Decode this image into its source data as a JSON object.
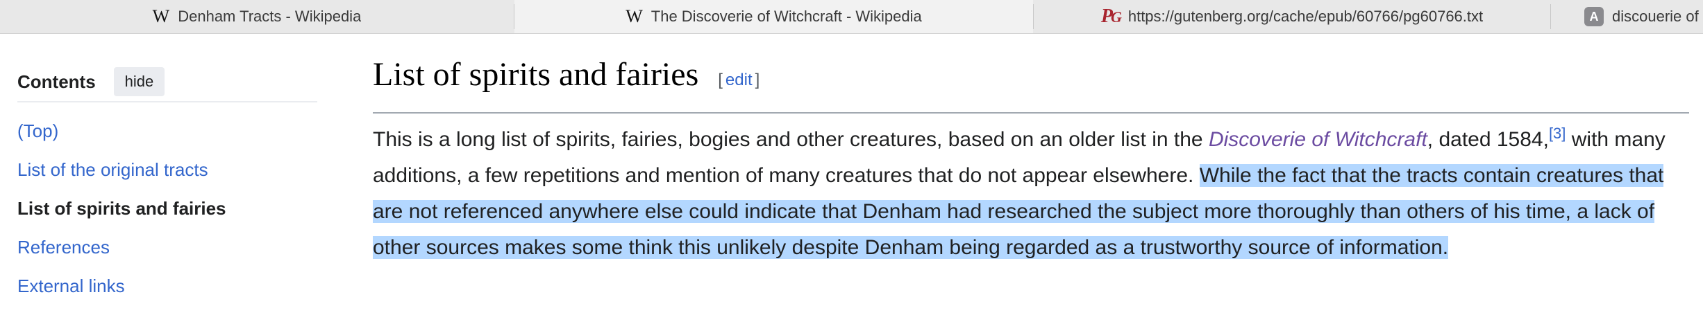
{
  "tabs": [
    {
      "favicon": "wikipedia-w-icon",
      "favicon_text": "W",
      "title": "Denham Tracts - Wikipedia",
      "active": false
    },
    {
      "favicon": "wikipedia-w-icon",
      "favicon_text": "W",
      "title": "The Discoverie of Witchcraft - Wikipedia",
      "active": true
    },
    {
      "favicon": "gutenberg-pg-icon",
      "favicon_text": "PG",
      "title": "https://gutenberg.org/cache/epub/60766/pg60766.txt",
      "active": false
    },
    {
      "favicon": "a-letter-icon",
      "favicon_text": "A",
      "title": "discouerie of",
      "active": false
    }
  ],
  "toc": {
    "title": "Contents",
    "hide_label": "hide",
    "items": [
      {
        "label": "(Top)",
        "current": false
      },
      {
        "label": "List of the original tracts",
        "current": false
      },
      {
        "label": "List of spirits and fairies",
        "current": true
      },
      {
        "label": "References",
        "current": false
      },
      {
        "label": "External links",
        "current": false
      }
    ]
  },
  "article": {
    "heading": "List of spirits and fairies",
    "edit_open": "[",
    "edit_label": "edit",
    "edit_close": "]",
    "para_part1": "This is a long list of spirits, fairies, bogies and other creatures, based on an older list in the ",
    "para_link": "Discoverie of Witchcraft",
    "para_part2": ", dated 1584,",
    "para_ref": "[3]",
    "para_part3": " with many additions, a few repetitions and mention of many creatures that do not appear elsewhere. ",
    "para_selected": "While the fact that the tracts contain creatures that are not referenced anywhere else could indicate that Denham had researched the subject more thoroughly than others of his time, a lack of other sources makes some think this unlikely despite Denham being regarded as a trustworthy source of information."
  },
  "colors": {
    "link": "#3366cc",
    "visited_link": "#6b4ba1",
    "selection": "#b3d7ff",
    "tab_strip": "#e8e8e8"
  }
}
